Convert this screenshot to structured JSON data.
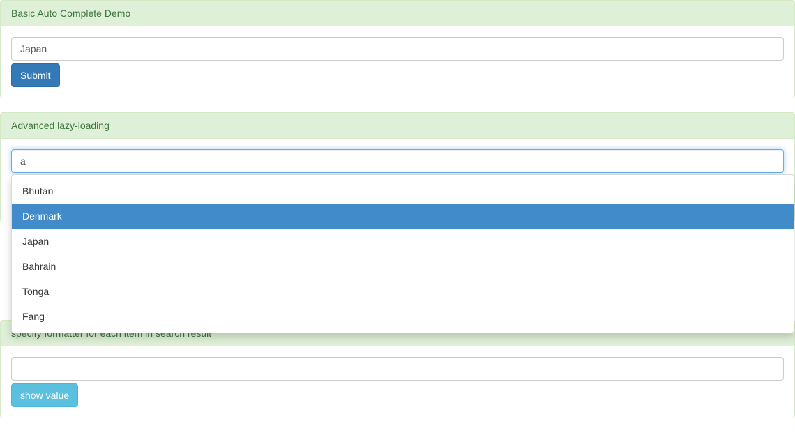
{
  "panels": {
    "basic": {
      "title": "Basic Auto Complete Demo",
      "input_value": "Japan",
      "submit_label": "Submit"
    },
    "advanced": {
      "title": "Advanced lazy-loading",
      "input_value": "a",
      "suggestions": [
        {
          "label": "Bhutan",
          "active": false
        },
        {
          "label": "Denmark",
          "active": true
        },
        {
          "label": "Japan",
          "active": false
        },
        {
          "label": "Bahrain",
          "active": false
        },
        {
          "label": "Tonga",
          "active": false
        },
        {
          "label": "Fang",
          "active": false
        }
      ]
    },
    "formatter": {
      "title": "specify formatter for each item in search result",
      "input_value": "",
      "button_label": "show value"
    }
  }
}
